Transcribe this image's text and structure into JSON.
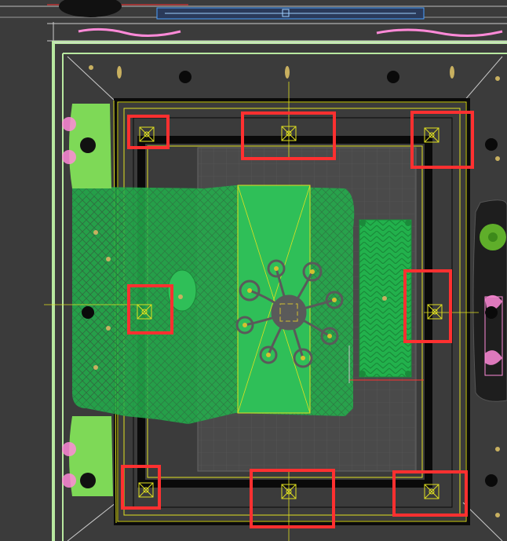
{
  "viewport": {
    "type": "cad-top-view",
    "background": "#3b3b3b"
  },
  "colors": {
    "wall_green": "#b8e8a0",
    "frame_black": "#0a0a0a",
    "ceiling_yellow": "#e0e020",
    "rug_gray": "#4a4a4a",
    "bed_green": "#22b14c",
    "mesh_green": "#3a7a4a",
    "nightstand_green": "#7ed957",
    "selection_red": "#ff3030",
    "chandelier_gray": "#5a5a5a",
    "bulb_yellow": "#d4c030",
    "plant_pink": "#ff8ad8",
    "sofa_dark": "#1e1e1e"
  },
  "icons": {
    "downlight": "downlight-icon",
    "spotlight": "spotlight-icon",
    "chandelier": "chandelier-icon",
    "selection": "selection-box"
  }
}
